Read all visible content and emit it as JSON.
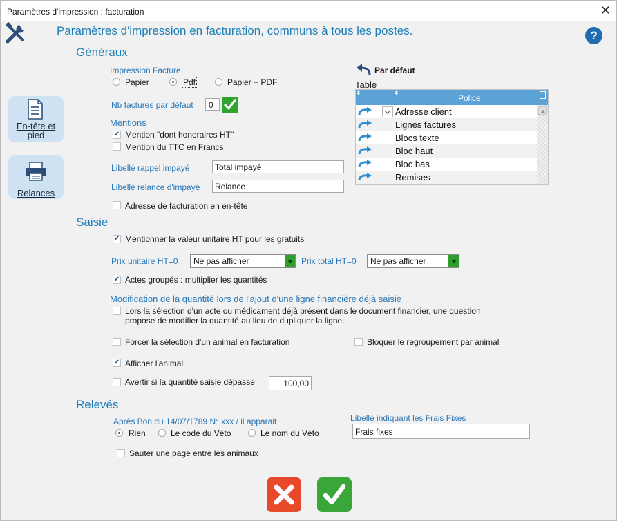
{
  "window": {
    "title": "Paramètres  d'impression : facturation",
    "close_label": "✕"
  },
  "header": {
    "title": "Paramètres d'impression en facturation, communs à tous les  postes.",
    "help_label": "?"
  },
  "sidebar": {
    "items": [
      {
        "label_line1": "En-tête et",
        "label_line2": "pied"
      },
      {
        "label": "Relances"
      }
    ]
  },
  "generaux": {
    "heading": "Généraux",
    "impression_label": "Impression Facture",
    "options": [
      "Papier",
      "Pdf",
      "Papier + PDF"
    ],
    "selected": "Pdf",
    "nb_factures_label": "Nb factures par défaut",
    "nb_factures_value": "0",
    "mentions_label": "Mentions",
    "mention_honoraires": "Mention \"dont honoraires HT\"",
    "mention_honoraires_checked": true,
    "mention_ttc": "Mention du TTC en Francs",
    "mention_ttc_checked": false,
    "libelle_rappel_label": "Libellé rappel impayé",
    "libelle_rappel_value": "Total impayé",
    "libelle_relance_label": "Libellé relance d'impayé",
    "libelle_relance_value": "Relance",
    "adresse_entete": "Adresse de facturation en en-tête",
    "adresse_entete_checked": false
  },
  "police_table": {
    "par_defaut_label": "Par défaut",
    "table_label": "Table",
    "column_header": "Police",
    "rows": [
      "Adresse client",
      "Lignes factures",
      "Blocs texte",
      "Bloc haut",
      "Bloc bas",
      "Remises"
    ]
  },
  "saisie": {
    "heading": "Saisie",
    "valeur_unitaire": "Mentionner la valeur unitaire HT pour les gratuits",
    "valeur_unitaire_checked": true,
    "prix_unitaire_label": "Prix unitaire HT=0",
    "prix_unitaire_value": "Ne pas afficher",
    "prix_total_label": "Prix total HT=0",
    "prix_total_value": "Ne pas afficher",
    "actes_groupes": "Actes groupés : multiplier les quantités",
    "actes_groupes_checked": true,
    "modification_heading": "Modification de la quantité lors de l'ajout d'une ligne financière déjà saisie",
    "modification_line1": "Lors la sélection d'un acte ou médicament déjà présent dans le document financier, une question",
    "modification_line2": "propose de modifier la quantité au lieu de dupliquer la ligne.",
    "modification_checked": false,
    "forcer_selection": "Forcer la sélection d'un animal en facturation",
    "forcer_selection_checked": false,
    "bloquer_regroupement": "Bloquer le regroupement par animal",
    "bloquer_regroupement_checked": false,
    "afficher_animal": "Afficher l'animal",
    "afficher_animal_checked": true,
    "avertir_label": "Avertir si la quantité saisie dépasse",
    "avertir_checked": false,
    "avertir_value": "100,00"
  },
  "releves": {
    "heading": "Relevés",
    "apres_bon_label": "Après Bon du 14/07/1789 N° xxx /  il apparait",
    "options": [
      "Rien",
      "Le code du Véto",
      "Le nom du Véto"
    ],
    "selected": "Rien",
    "frais_fixes_label": "Libellé indiquant les Frais Fixes",
    "frais_fixes_value": "Frais fixes",
    "sauter_page": "Sauter une page entre les animaux",
    "sauter_page_checked": false
  },
  "colors": {
    "accent": "#1d7fb8",
    "cancel": "#e8492b",
    "ok": "#3aa63a",
    "table_header": "#5ba3d6"
  }
}
